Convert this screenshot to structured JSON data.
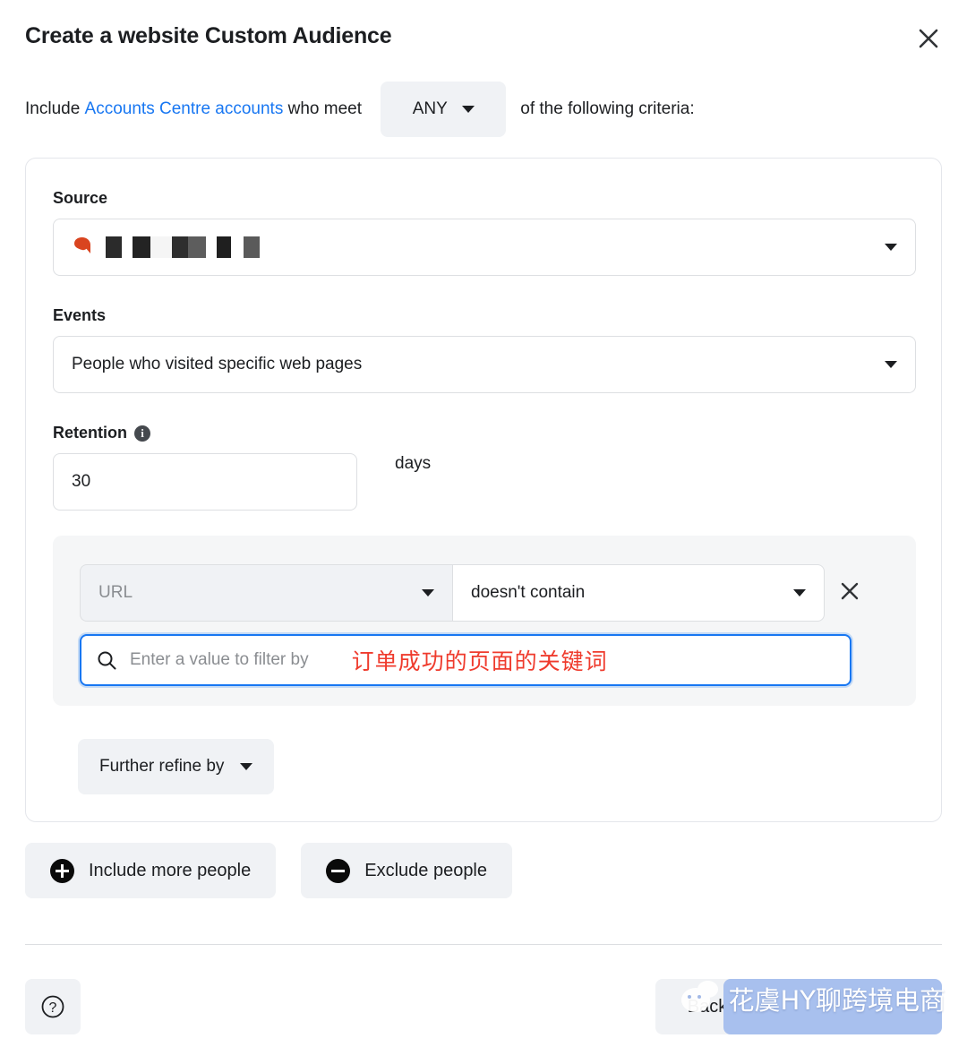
{
  "dialog": {
    "title": "Create a website Custom Audience",
    "close_icon": "close-icon"
  },
  "include_row": {
    "prefix": "Include ",
    "link_text": "Accounts Centre accounts",
    "middle": " who meet ",
    "match_selector_value": "ANY",
    "suffix": "of the following criteria:"
  },
  "card": {
    "source": {
      "label": "Source",
      "value_redacted": true,
      "value": ""
    },
    "events": {
      "label": "Events",
      "value": "People who visited specific web pages"
    },
    "retention": {
      "label": "Retention",
      "info_icon": "info-icon",
      "value": "30",
      "unit": "days"
    },
    "filter": {
      "field_value": "URL",
      "operator_value": "doesn't contain",
      "remove_icon": "close-icon",
      "search_icon": "search-icon",
      "search_placeholder": "Enter a value to filter by",
      "search_value": "",
      "annotation_text": "订单成功的页面的关键词",
      "annotation_color": "#ef3b2d"
    },
    "refine_label": "Further refine by"
  },
  "audience_actions": {
    "include_more_label": "Include more people",
    "exclude_label": "Exclude people"
  },
  "footer": {
    "help_label": "?",
    "back_label": "Back",
    "primary_label": ""
  },
  "watermark": {
    "text": "花虞HY聊跨境电商",
    "logo": "wechat-icon"
  },
  "colors": {
    "accent_blue": "#1877f2",
    "primary_button": "#a8c0ee",
    "annotation_red": "#ef3b2d",
    "control_gray": "#f0f2f5",
    "group_gray": "#f5f6f7"
  }
}
